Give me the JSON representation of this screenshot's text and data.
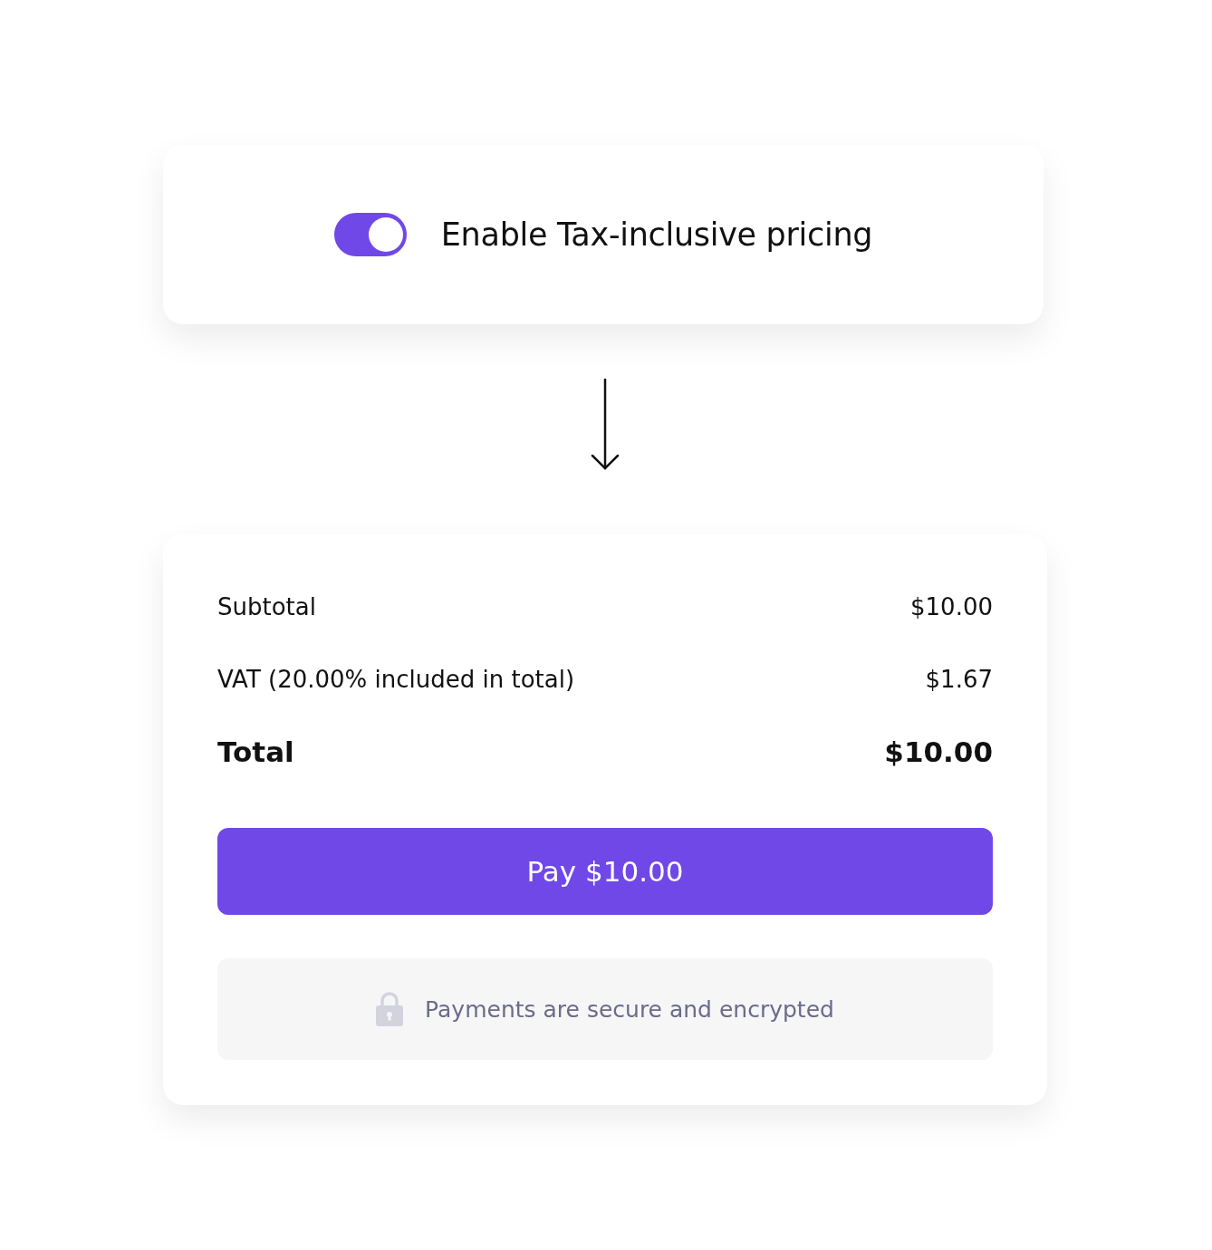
{
  "setting": {
    "label": "Enable Tax-inclusive pricing",
    "on": true
  },
  "summary": {
    "rows": [
      {
        "kind": "line",
        "label": "Subtotal",
        "amount": "$10.00"
      },
      {
        "kind": "line",
        "label": "VAT (20.00% included in total)",
        "amount": "$1.67"
      },
      {
        "kind": "total",
        "label": "Total",
        "amount": "$10.00"
      }
    ],
    "pay_button": "Pay $10.00",
    "secure_note": "Payments are secure and encrypted"
  }
}
